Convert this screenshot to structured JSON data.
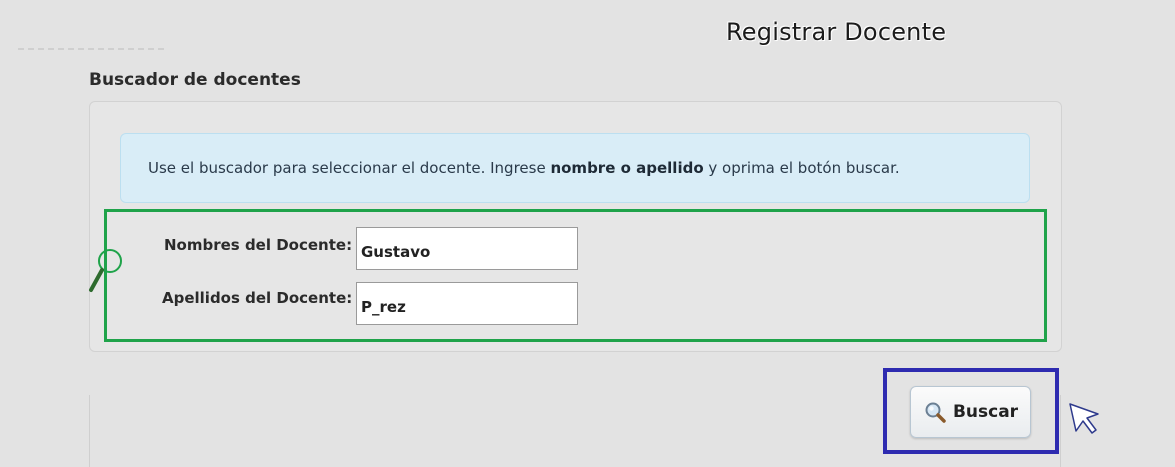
{
  "page": {
    "title": "Registrar Docente",
    "section_title": "Buscador de docentes"
  },
  "alert": {
    "text_before": "Use el buscador para seleccionar el docente. Ingrese ",
    "text_bold": "nombre o apellido",
    "text_after": " y oprima el botón buscar."
  },
  "form": {
    "nombres_label": "Nombres del Docente:",
    "nombres_value": "Gustavo",
    "apellidos_label": "Apellidos del Docente:",
    "apellidos_value": "P_rez"
  },
  "actions": {
    "search_label": "Buscar",
    "search_icon": "magnifier-icon"
  },
  "colors": {
    "form_highlight": "#1fa34a",
    "button_highlight": "#2e2bb0",
    "alert_background": "#d9edf7"
  }
}
